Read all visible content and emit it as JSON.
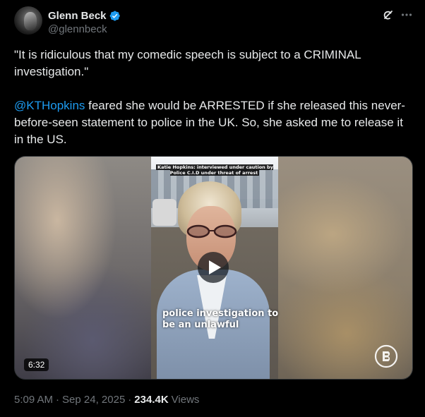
{
  "author": {
    "display_name": "Glenn Beck",
    "handle": "@glennbeck",
    "verified": true
  },
  "icons": {
    "verified": "verified-badge-icon",
    "grok": "grok-icon",
    "more": "more-icon",
    "play": "play-icon",
    "brand": "blaze-logo-icon"
  },
  "tweet": {
    "paragraph1": "\"It is ridiculous that my comedic speech is subject to a CRIMINAL investigation.\"",
    "mention": "@KTHopkins",
    "paragraph2_rest": " feared she would be ARRESTED if she released this never-before-seen statement to police in the UK. So, she asked me to release it in the US."
  },
  "media": {
    "caption_top": "Katie Hopkins: interviewed under caution by Police C.I.D under threat of arrest",
    "subtitle": "police investigation to be an unlawful",
    "duration": "6:32"
  },
  "meta": {
    "time": "5:09 AM",
    "date": "Sep 24, 2025",
    "views_count": "234.4K",
    "views_label": "Views"
  },
  "colors": {
    "background": "#000000",
    "text": "#e7e9ea",
    "secondary": "#71767b",
    "accent": "#1d9bf0"
  }
}
